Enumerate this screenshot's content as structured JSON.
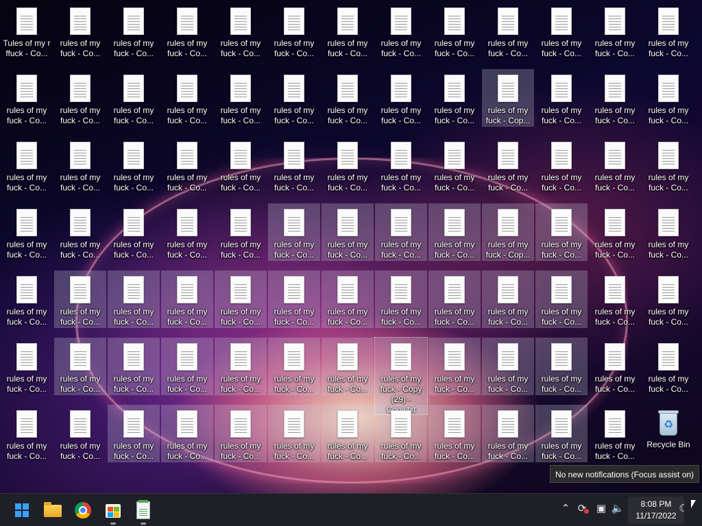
{
  "desktop": {
    "file_label": "rules of my\nfuck - Co...",
    "file_label_alt": "rules of my\nfuck - Cop...",
    "file_label_focused": "rules of my\nfuck - Copy\n(29) -\nCopy.txt",
    "file_label_overlap": "Tules of my r\nffuck - Co...",
    "recycle_bin_label": "Recycle Bin"
  },
  "notification": {
    "text": "No new notifications (Focus assist on)"
  },
  "taskbar": {
    "apps": [
      {
        "name": "start",
        "icon": "windows-logo-icon"
      },
      {
        "name": "file-explorer",
        "icon": "folder-icon"
      },
      {
        "name": "chrome",
        "icon": "chrome-icon"
      },
      {
        "name": "microsoft-store",
        "icon": "store-icon"
      },
      {
        "name": "notepad",
        "icon": "notepad-icon"
      }
    ],
    "tray": {
      "chevron": "^",
      "clock_time": "8:08 PM",
      "clock_date": "11/17/2022"
    }
  }
}
